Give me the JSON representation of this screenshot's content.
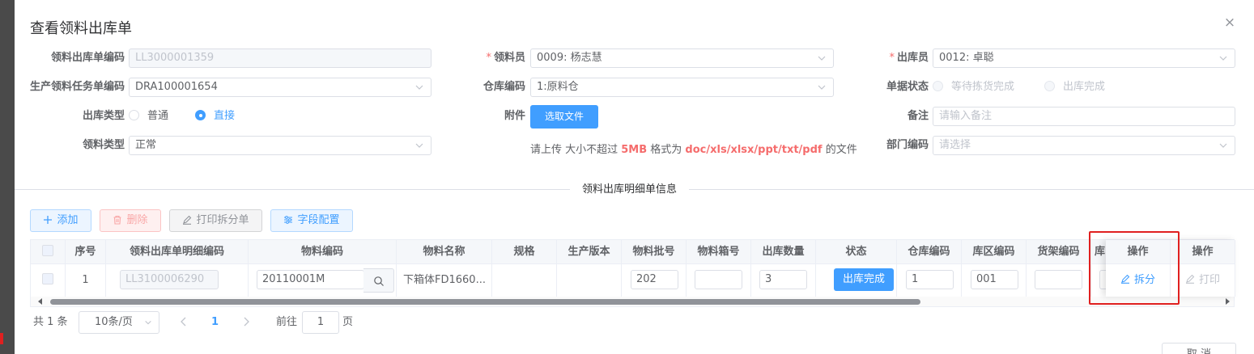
{
  "dialog": {
    "title": "查看领料出库单",
    "close_glyph": "×"
  },
  "form": {
    "order_code": {
      "label": "领料出库单编码",
      "value": "LL3000001359"
    },
    "picker": {
      "required": "*",
      "label": "领料员",
      "value": "0009: 杨志慧"
    },
    "issuer": {
      "required": "*",
      "label": "出库员",
      "value": "0012: 卓聪"
    },
    "task_code": {
      "label": "生产领料任务单编码",
      "value": "DRA100001654"
    },
    "warehouse": {
      "label": "仓库编码",
      "value": "1:原料仓"
    },
    "doc_status": {
      "label": "单据状态",
      "options": [
        "等待拣货完成",
        "出库完成"
      ]
    },
    "out_type": {
      "label": "出库类型",
      "options": [
        "普通",
        "直接"
      ],
      "selected": "直接"
    },
    "attachment": {
      "label": "附件",
      "button": "选取文件"
    },
    "remark": {
      "label": "备注",
      "placeholder": "请输入备注"
    },
    "pick_type": {
      "label": "领料类型",
      "value": "正常"
    },
    "dept_code": {
      "label": "部门编码",
      "placeholder": "请选择"
    },
    "upload_hint": {
      "prefix": "请上传 大小不超过 ",
      "size": "5MB",
      "middle": " 格式为 ",
      "formats": "doc/xls/xlsx/ppt/txt/pdf",
      "suffix": " 的文件"
    }
  },
  "section_title": "领料出库明细单信息",
  "toolbar": {
    "add": "添加",
    "delete": "删除",
    "print_split": "打印拆分单",
    "field_config": "字段配置"
  },
  "table": {
    "headers": [
      "序号",
      "领料出库单明细编码",
      "物料编码",
      "物料名称",
      "规格",
      "生产版本",
      "物料批号",
      "物料箱号",
      "出库数量",
      "状态",
      "仓库编码",
      "库区编码",
      "货架编码",
      "库",
      "操作",
      "操作"
    ],
    "row": {
      "index": "1",
      "detail_code": "LL3100006290",
      "material_code": "20110001M",
      "material_name": "下箱体FD1660...",
      "batch_no": "202",
      "quantity": "3",
      "status_button": "出库完成",
      "warehouse_code": "1",
      "area_code": "001",
      "split": "拆分",
      "print": "打印"
    }
  },
  "pager": {
    "total": "共 1 条",
    "page_size": "10条/页",
    "current": "1",
    "goto_prefix": "前往",
    "goto_value": "1",
    "goto_suffix": "页"
  },
  "footer": {
    "button": "取 消"
  },
  "colors": {
    "primary": "#409eff",
    "danger": "#f56c6c",
    "highlight": "#e02020"
  }
}
